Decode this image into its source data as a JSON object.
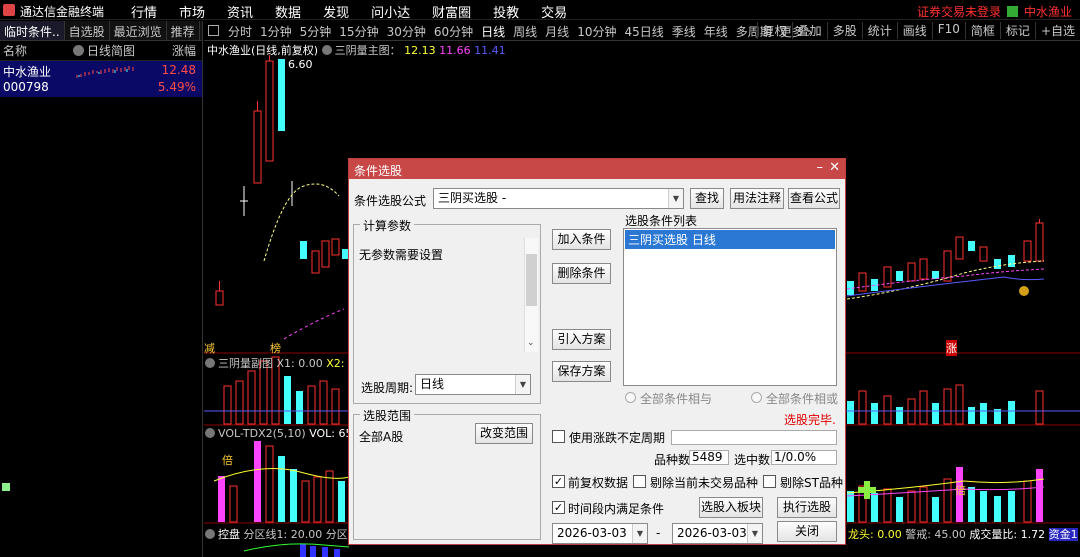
{
  "menubar": {
    "app_title": "通达信金融终端",
    "menus": [
      "行情",
      "市场",
      "资讯",
      "数据",
      "发现",
      "问小达",
      "财富圈",
      "投教",
      "交易"
    ],
    "right_text": "证券交易未登录",
    "stock_name": "中水渔业"
  },
  "left": {
    "tabs": [
      "临时条件..",
      "自选股",
      "最近浏览",
      "推荐"
    ],
    "header_name": "名称",
    "header_mini": "日线简图",
    "header_change": "涨幅",
    "stock": {
      "name": "中水渔业",
      "code": "000798",
      "price": "12.48",
      "change": "5.49%"
    }
  },
  "period_bar": {
    "periods": [
      "分时",
      "1分钟",
      "5分钟",
      "15分钟",
      "30分钟",
      "60分钟",
      "日线",
      "周线",
      "月线",
      "10分钟",
      "45日线",
      "季线",
      "年线",
      "多周期",
      "更多 ›"
    ],
    "active": "日线",
    "tools": [
      "复权",
      "叠加",
      "多股",
      "统计",
      "画线",
      "F10",
      "简框",
      "标记",
      "+自选"
    ]
  },
  "chart": {
    "main_title": "中水渔业(日线,前复权)",
    "main_indicator": "三阴量主图：",
    "main_v1": "12.13",
    "main_v2": "11.66",
    "main_v3": "11.41",
    "high_label": "6.60",
    "mark_jian": "减",
    "mark_bang": "榜",
    "mark_zhang": "涨",
    "sub1_title": "三阴量副图",
    "sub1_x1": "X1: 0.00",
    "sub1_x2": "X2: 0.",
    "sub2_title": "VOL-TDX2(5,10)",
    "sub2_vol": "VOL: 65",
    "sub3_title": "控盘",
    "sub3_val": "分区线1: 20.00",
    "sub3_val2": "分区线",
    "bottom_right_a": "龙头: 0.00",
    "bottom_right_b": "警戒: 45.00",
    "bottom_right_c": "成交量比: 1.72",
    "bottom_right_d": "资金1",
    "vol_mark": "倍"
  },
  "chart_data": {
    "type": "candlestick",
    "candles": [
      {
        "o": 2.0,
        "c": 2.6
      },
      {
        "o": 2.6,
        "c": 3.2
      },
      {
        "o": 3.2,
        "c": 4.0
      },
      {
        "o": 4.0,
        "c": 4.8
      },
      {
        "o": 4.8,
        "c": 5.7
      },
      {
        "o": 5.7,
        "c": 6.4
      },
      {
        "o": 6.3,
        "c": 5.9
      }
    ]
  },
  "dialog": {
    "title": "条件选股",
    "formula_label": "条件选股公式",
    "formula_value": "三阴买选股 -",
    "btn_find": "查找",
    "btn_usage": "用法注释",
    "btn_view": "查看公式",
    "params_title": "计算参数",
    "params_text": "无参数需要设置",
    "period_label": "选股周期:",
    "period_value": "日线",
    "scope_title": "选股范围",
    "scope_value": "全部A股",
    "btn_change_scope": "改变范围",
    "btn_add": "加入条件",
    "btn_delete": "删除条件",
    "btn_import": "引入方案",
    "btn_save": "保存方案",
    "list_title": "选股条件列表",
    "list_items": [
      "三阴买选股  日线"
    ],
    "radio_and": "全部条件相与",
    "radio_or": "全部条件相或",
    "status": "选股完毕.",
    "chk_uncertain": "使用涨跌不定周期",
    "count_label": "品种数",
    "count_value": "5489",
    "selected_label": "选中数",
    "selected_value": "1/0.0%",
    "chk_prefq": "前复权数据",
    "chk_exclude_untraded": "剔除当前未交易品种",
    "chk_exclude_st": "剔除ST品种",
    "chk_time_range": "时间段内满足条件",
    "btn_to_block": "选股入板块",
    "btn_execute": "执行选股",
    "date_from": "2026-03-03",
    "date_sep": "-",
    "date_to": "2026-03-03",
    "btn_close": "关闭"
  }
}
